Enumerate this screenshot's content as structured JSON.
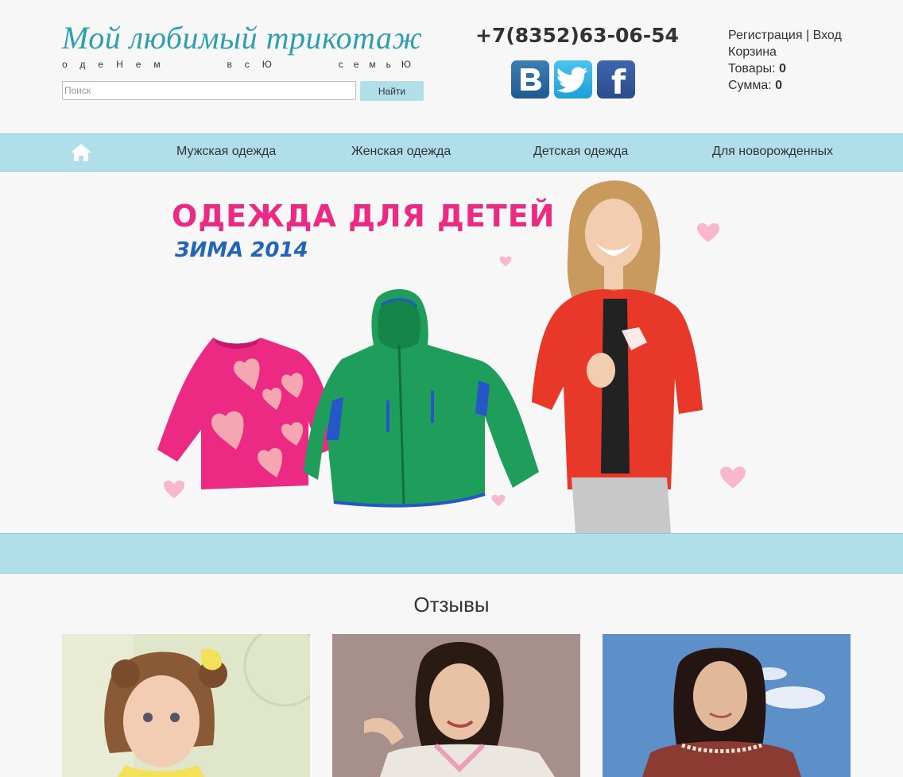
{
  "header": {
    "logo_title": "Мой любимый трикотаж",
    "logo_tagline_words": [
      "одеНем",
      "всЮ",
      "семьЮ"
    ],
    "search_placeholder": "Поиск",
    "search_button": "Найти",
    "phone": "+7(8352)63-06-54",
    "social": [
      {
        "icon": "vk-icon",
        "glyph": "B"
      },
      {
        "icon": "twitter-icon",
        "glyph": ""
      },
      {
        "icon": "facebook-icon",
        "glyph": "f"
      }
    ],
    "account": {
      "register": "Регистрация",
      "separator": "|",
      "login": "Вход",
      "cart": "Корзина",
      "items_label": "Товары:",
      "items_value": "0",
      "sum_label": "Сумма:",
      "sum_value": "0"
    }
  },
  "nav": {
    "home_icon": "home-icon",
    "items": [
      "Мужская одежда",
      "Женская одежда",
      "Детская одежда",
      "Для новорожденных"
    ]
  },
  "banner": {
    "title": "ОДЕЖДА ДЛЯ ДЕТЕЙ",
    "subtitle": "ЗИМА 2014"
  },
  "reviews": {
    "title": "Отзывы"
  },
  "colors": {
    "accent": "#b0dfea",
    "logo": "#2e9fb0",
    "banner_pink": "#ec2a84",
    "banner_blue": "#2264b8"
  }
}
